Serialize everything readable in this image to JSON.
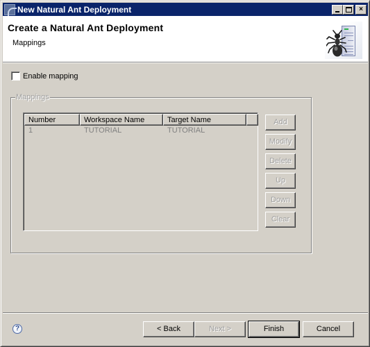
{
  "window": {
    "title": "New Natural Ant Deployment",
    "controls": {
      "minimize": "minimize",
      "maximize": "maximize",
      "close": "×"
    }
  },
  "header": {
    "title": "Create a Natural Ant Deployment",
    "subtitle": "Mappings",
    "icon": "ant-server-icon"
  },
  "enable_mapping": {
    "label": "Enable mapping",
    "checked": false
  },
  "mappings": {
    "group_label": "Mappings",
    "columns": [
      "Number",
      "Workspace Name",
      "Target Name",
      ""
    ],
    "rows": [
      {
        "number": "1",
        "workspace": "TUTORIAL",
        "target": "TUTORIAL"
      }
    ],
    "buttons": {
      "add": "Add",
      "modify": "Modify",
      "delete": "Delete",
      "up": "Up",
      "down": "Down",
      "clear": "Clear"
    }
  },
  "footer": {
    "help_icon": "?",
    "back": "< Back",
    "next": "Next >",
    "finish": "Finish",
    "cancel": "Cancel"
  }
}
